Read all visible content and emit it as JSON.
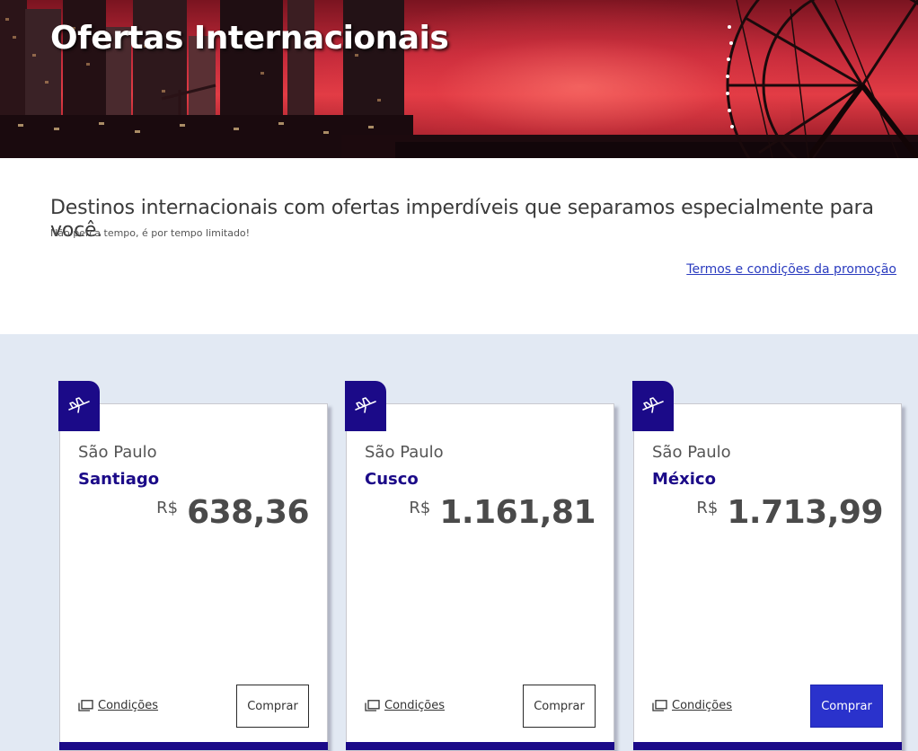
{
  "hero": {
    "title": "Ofertas Internacionais"
  },
  "intro": {
    "heading": "Destinos internacionais com ofertas imperdíveis que separamos especialmente para você.",
    "subheading": "Não perca tempo, é por tempo limitado!",
    "terms_link": "Termos e condições da promoção"
  },
  "colors": {
    "brand": "#1b0a88",
    "link": "#2a3bbf",
    "button_active": "#2a32cc",
    "section_bg": "#e2e9f3"
  },
  "offers": [
    {
      "origin": "São Paulo",
      "destination": "Santiago",
      "currency": "R$",
      "price": "638,36",
      "conditions_label": "Condições",
      "buy_label": "Comprar",
      "flag_icon": "airplane-icon",
      "conditions_icon": "copy-icon"
    },
    {
      "origin": "São Paulo",
      "destination": "Cusco",
      "currency": "R$",
      "price": "1.161,81",
      "conditions_label": "Condições",
      "buy_label": "Comprar",
      "flag_icon": "airplane-icon",
      "conditions_icon": "copy-icon"
    },
    {
      "origin": "São Paulo",
      "destination": "México",
      "currency": "R$",
      "price": "1.713,99",
      "conditions_label": "Condições",
      "buy_label": "Comprar",
      "flag_icon": "airplane-icon",
      "conditions_icon": "copy-icon"
    }
  ]
}
